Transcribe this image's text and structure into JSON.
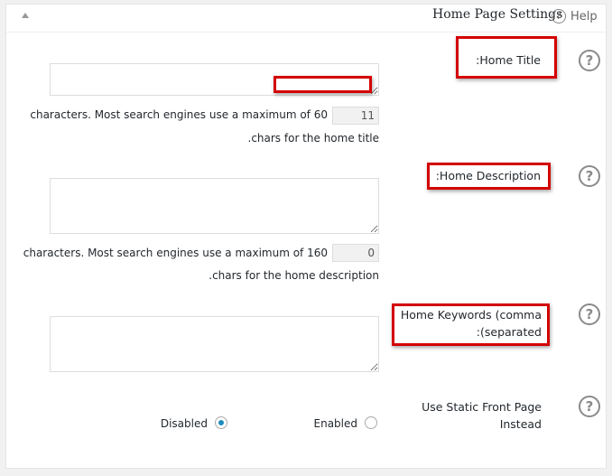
{
  "header": {
    "title": "Home Page Settings",
    "help_label": "Help",
    "help_icon": "?"
  },
  "home_title": {
    "label": ":Home Title",
    "help_icon": "?",
    "value": "",
    "count": "11",
    "note_line1": "characters. Most search engines use a maximum of 60",
    "note_line2": ".chars for the home title"
  },
  "home_description": {
    "label": ":Home Description",
    "help_icon": "?",
    "value": "",
    "count": "0",
    "note_line1": "characters. Most search engines use a maximum of 160",
    "note_line2": ".chars for the home description"
  },
  "home_keywords": {
    "label_line1": "Home Keywords (comma",
    "label_line2": ":(separated",
    "help_icon": "?",
    "value": ""
  },
  "static_front_page": {
    "label_line1": "Use Static Front Page",
    "label_line2": "Instead",
    "help_icon": "?",
    "options": [
      {
        "label": "Disabled",
        "selected": true
      },
      {
        "label": "Enabled",
        "selected": false
      }
    ]
  },
  "colors": {
    "highlight_red": "#d40000",
    "radio_accent": "#1e8cbe"
  }
}
